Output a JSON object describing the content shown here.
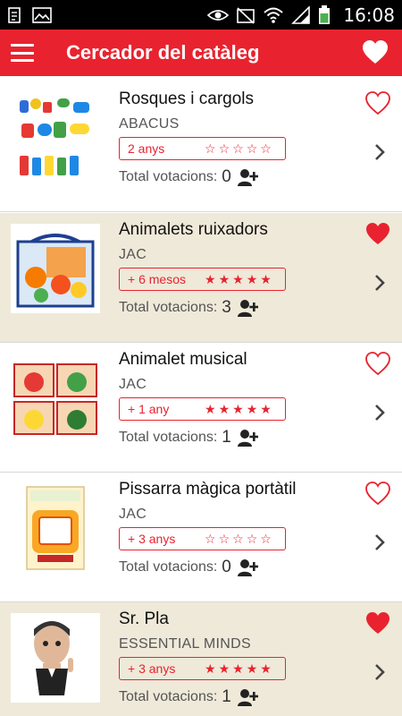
{
  "status_bar": {
    "time": "16:08",
    "icons": [
      "notes-icon",
      "image-icon",
      "eye-icon",
      "no-signal-icon",
      "wifi-icon",
      "signal-icon",
      "battery-icon"
    ]
  },
  "app_bar": {
    "title": "Cercador del catàleg",
    "menu_icon": "hamburger-menu-icon",
    "action_icon": "heart-icon"
  },
  "colors": {
    "accent": "#e8232f",
    "favorite_bg": "#efe9d9",
    "white": "#ffffff"
  },
  "votes_label": "Total votacions:",
  "items": [
    {
      "title": "Rosques i cargols",
      "brand": "ABACUS",
      "age": "2 anys",
      "rating": 0,
      "votes": "0",
      "favorite": false
    },
    {
      "title": "Animalets ruixadors",
      "brand": "JAC",
      "age": "+ 6 mesos",
      "rating": 5,
      "votes": "3",
      "favorite": true
    },
    {
      "title": "Animalet musical",
      "brand": "JAC",
      "age": "+ 1 any",
      "rating": 5,
      "votes": "1",
      "favorite": false
    },
    {
      "title": "Pissarra màgica portàtil",
      "brand": "JAC",
      "age": "+ 3 anys",
      "rating": 0,
      "votes": "0",
      "favorite": false
    },
    {
      "title": "Sr. Pla",
      "brand": "ESSENTIAL MINDS",
      "age": "+ 3 anys",
      "rating": 5,
      "votes": "1",
      "favorite": true
    }
  ]
}
